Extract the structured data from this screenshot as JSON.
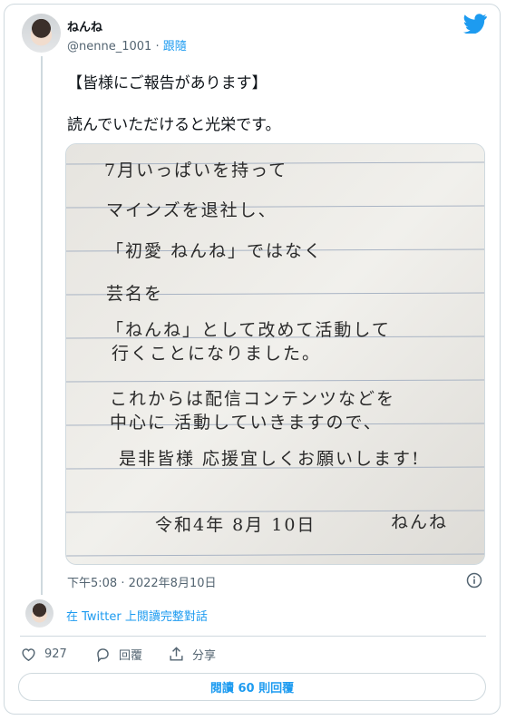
{
  "tweet": {
    "display_name": "ねんね",
    "handle": "@nenne_1001",
    "separator": " · ",
    "follow_label": "跟隨",
    "text_line1": "【皆様にご報告があります】",
    "text_line2": "読んでいただけると光栄です。",
    "timestamp": "下午5:08 · 2022年8月10日"
  },
  "letter": {
    "lines": [
      "7月いっぱいを持って",
      "マインズを退社し、",
      "「初愛 ねんね」ではなく",
      "芸名を",
      "「ねんね」として改めて活動して",
      "行くことになりました。",
      "これからは配信コンテンツなどを",
      "中心に 活動していきますので、",
      "是非皆様 応援宜しくお願いします!",
      "令和4年 8月 10日",
      "ねんね"
    ]
  },
  "conversation": {
    "read_label": "在 Twitter 上閱讀完整對話"
  },
  "actions": {
    "like_count": "927",
    "reply_label": "回覆",
    "share_label": "分享",
    "read_replies_label": "閱讀 60 則回覆"
  },
  "colors": {
    "accent": "#1d9bf0",
    "secondary_text": "#536471",
    "border": "#cfd9de"
  },
  "icons": [
    "twitter-bird-icon",
    "info-icon",
    "heart-icon",
    "reply-icon",
    "share-icon"
  ]
}
